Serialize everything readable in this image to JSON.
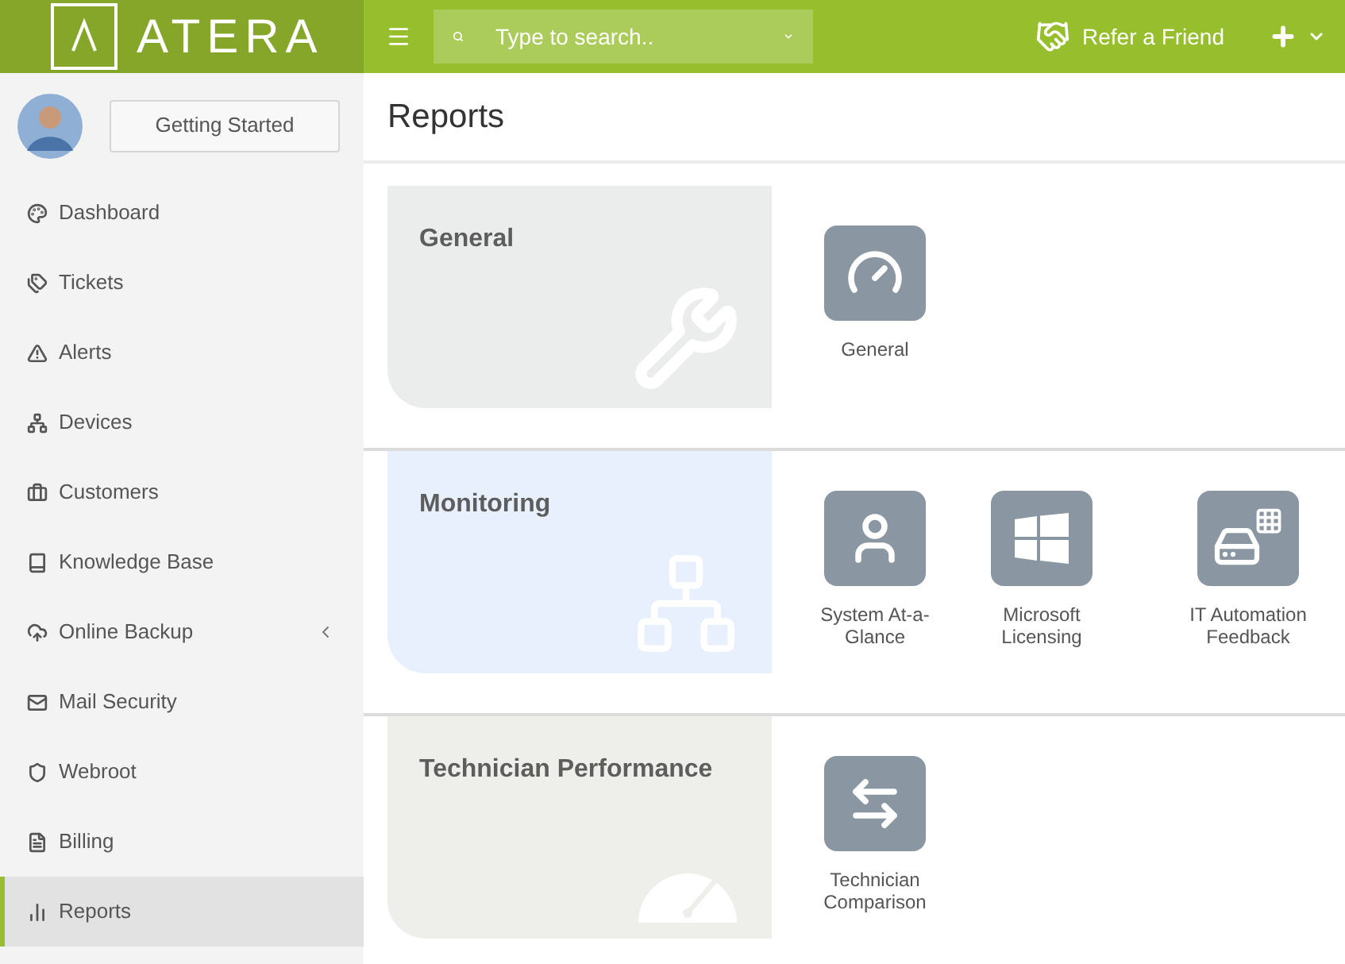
{
  "topbar": {
    "logo": "ATERA",
    "search": {
      "placeholder": "Type to search.."
    },
    "refer": "Refer a Friend"
  },
  "sidebar": {
    "getting_started": "Getting Started",
    "items": [
      {
        "label": "Dashboard",
        "kind": "dashboard",
        "selected": false,
        "expandable": false
      },
      {
        "label": "Tickets",
        "kind": "tickets",
        "selected": false,
        "expandable": false
      },
      {
        "label": "Alerts",
        "kind": "alerts",
        "selected": false,
        "expandable": false
      },
      {
        "label": "Devices",
        "kind": "devices",
        "selected": false,
        "expandable": false
      },
      {
        "label": "Customers",
        "kind": "customers",
        "selected": false,
        "expandable": false
      },
      {
        "label": "Knowledge Base",
        "kind": "book",
        "selected": false,
        "expandable": false
      },
      {
        "label": "Online Backup",
        "kind": "backup",
        "selected": false,
        "expandable": true
      },
      {
        "label": "Mail Security",
        "kind": "mail",
        "selected": false,
        "expandable": false
      },
      {
        "label": "Webroot",
        "kind": "shield",
        "selected": false,
        "expandable": false
      },
      {
        "label": "Billing",
        "kind": "billing",
        "selected": false,
        "expandable": false
      },
      {
        "label": "Reports",
        "kind": "reports",
        "selected": true,
        "expandable": false
      }
    ]
  },
  "page": {
    "title": "Reports",
    "sections": [
      {
        "title": "General",
        "kind": "wrench",
        "color": "#ebedec",
        "reports": [
          {
            "label": "General",
            "kind": "gauge"
          }
        ]
      },
      {
        "title": "Monitoring",
        "kind": "network",
        "color": "#e8f0fd",
        "reports": [
          {
            "label": "System At-a-Glance",
            "kind": "person"
          },
          {
            "label": "Microsoft Licensing",
            "kind": "windows"
          },
          {
            "label": "IT Automation Feedback",
            "kind": "drive"
          }
        ]
      },
      {
        "title": "Technician Performance",
        "kind": "speedometer",
        "color": "#eeeeea",
        "reports": [
          {
            "label": "Technician Comparison",
            "kind": "arrows"
          }
        ]
      }
    ]
  }
}
